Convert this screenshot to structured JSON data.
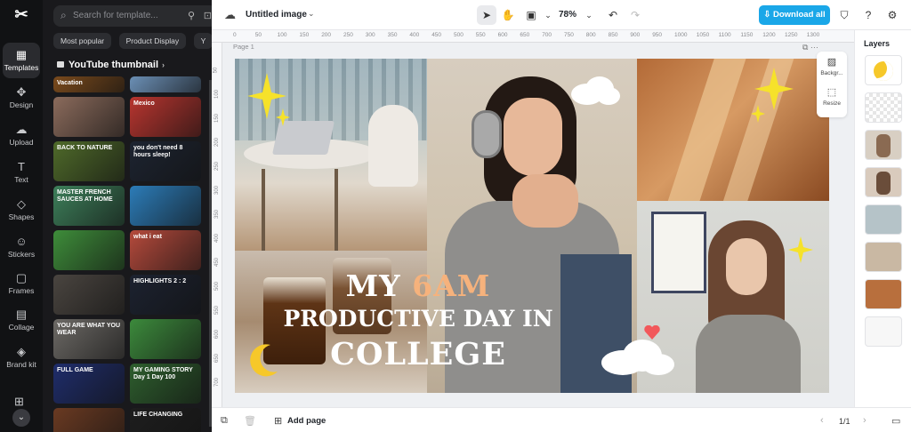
{
  "app": {
    "doc_title": "Untitled image",
    "zoom": "78%",
    "download_label": "Download all",
    "accent": "#1aa7e8"
  },
  "rail": {
    "items": [
      {
        "label": "Templates",
        "icon": "templates-icon"
      },
      {
        "label": "Design",
        "icon": "design-icon"
      },
      {
        "label": "Upload",
        "icon": "upload-icon"
      },
      {
        "label": "Text",
        "icon": "text-icon"
      },
      {
        "label": "Shapes",
        "icon": "shapes-icon"
      },
      {
        "label": "Stickers",
        "icon": "stickers-icon"
      },
      {
        "label": "Frames",
        "icon": "frames-icon"
      },
      {
        "label": "Collage",
        "icon": "collage-icon"
      },
      {
        "label": "Brand kit",
        "icon": "brand-kit-icon"
      }
    ]
  },
  "panel": {
    "search_placeholder": "Search for template...",
    "chips": [
      "Most popular",
      "Product Display",
      "Y"
    ],
    "category": "YouTube thumbnail",
    "thumbs": [
      {
        "text": "Vacation",
        "bg": "#7a4a1c"
      },
      {
        "text": "",
        "bg": "#6b8fb5"
      },
      {
        "text": "",
        "bg": "#8b6b5c"
      },
      {
        "text": "Mexico",
        "bg": "#b8352f"
      },
      {
        "text": "BACK TO NATURE",
        "bg": "#4f6a2a"
      },
      {
        "text": "you don't need 8 hours sleep!",
        "bg": "#1d2431"
      },
      {
        "text": "MASTER FRENCH SAUCES AT HOME",
        "bg": "#3d7f5a"
      },
      {
        "text": "",
        "bg": "#2c7cb8"
      },
      {
        "text": "",
        "bg": "#3e8d3a"
      },
      {
        "text": "what i eat",
        "bg": "#b54a3c"
      },
      {
        "text": "",
        "bg": "#4a4540"
      },
      {
        "text": "HIGHLIGHTS 2 : 2",
        "bg": "#1c2230"
      },
      {
        "text": "YOU ARE WHAT YOU WEAR",
        "bg": "#6d6a66"
      },
      {
        "text": "",
        "bg": "#3c8a3c"
      },
      {
        "text": "FULL GAME",
        "bg": "#1f2d6b"
      },
      {
        "text": "MY GAMING STORY Day 1 Day 100",
        "bg": "#2e5e2e"
      },
      {
        "text": "",
        "bg": "#6a3a22"
      },
      {
        "text": "LIFE CHANGING",
        "bg": "#1e1e1e"
      }
    ]
  },
  "canvas": {
    "page_label": "Page 1",
    "ruler_ticks": [
      "0",
      "50",
      "100",
      "150",
      "200",
      "250",
      "300",
      "350",
      "400",
      "450",
      "500",
      "550",
      "600",
      "650",
      "700",
      "750",
      "800",
      "850",
      "900",
      "950",
      "1000",
      "1050",
      "1100",
      "1150",
      "1200",
      "1250",
      "1300"
    ],
    "ruler_v_ticks": [
      "50",
      "100",
      "150",
      "200",
      "250",
      "300",
      "350",
      "400",
      "450",
      "500",
      "550",
      "600",
      "650",
      "700"
    ],
    "title": {
      "line1_a": "MY",
      "line1_b": "6AM",
      "line2": "PRODUCTIVE DAY IN",
      "line3": "COLLEGE"
    },
    "side_tools": [
      "Backgr...",
      "Resize"
    ]
  },
  "layers": {
    "header": "Layers"
  },
  "bottom": {
    "add_page": "Add page",
    "page_counter": "1/1"
  }
}
